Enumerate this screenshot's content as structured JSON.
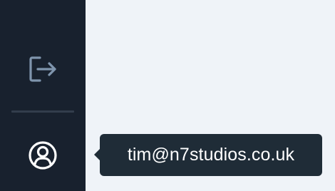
{
  "sidebar": {
    "items": [
      {
        "icon": "logout-icon"
      },
      {
        "icon": "user-circle-icon"
      }
    ]
  },
  "tooltip": {
    "text": "tim@n7studios.co.uk"
  },
  "colors": {
    "sidebar_bg": "#18212e",
    "page_bg": "#eff3f8",
    "divider": "#323d4c",
    "tooltip_bg": "#1f2c37",
    "logout_icon": "#7f95ad",
    "profile_icon": "#ffffff"
  }
}
